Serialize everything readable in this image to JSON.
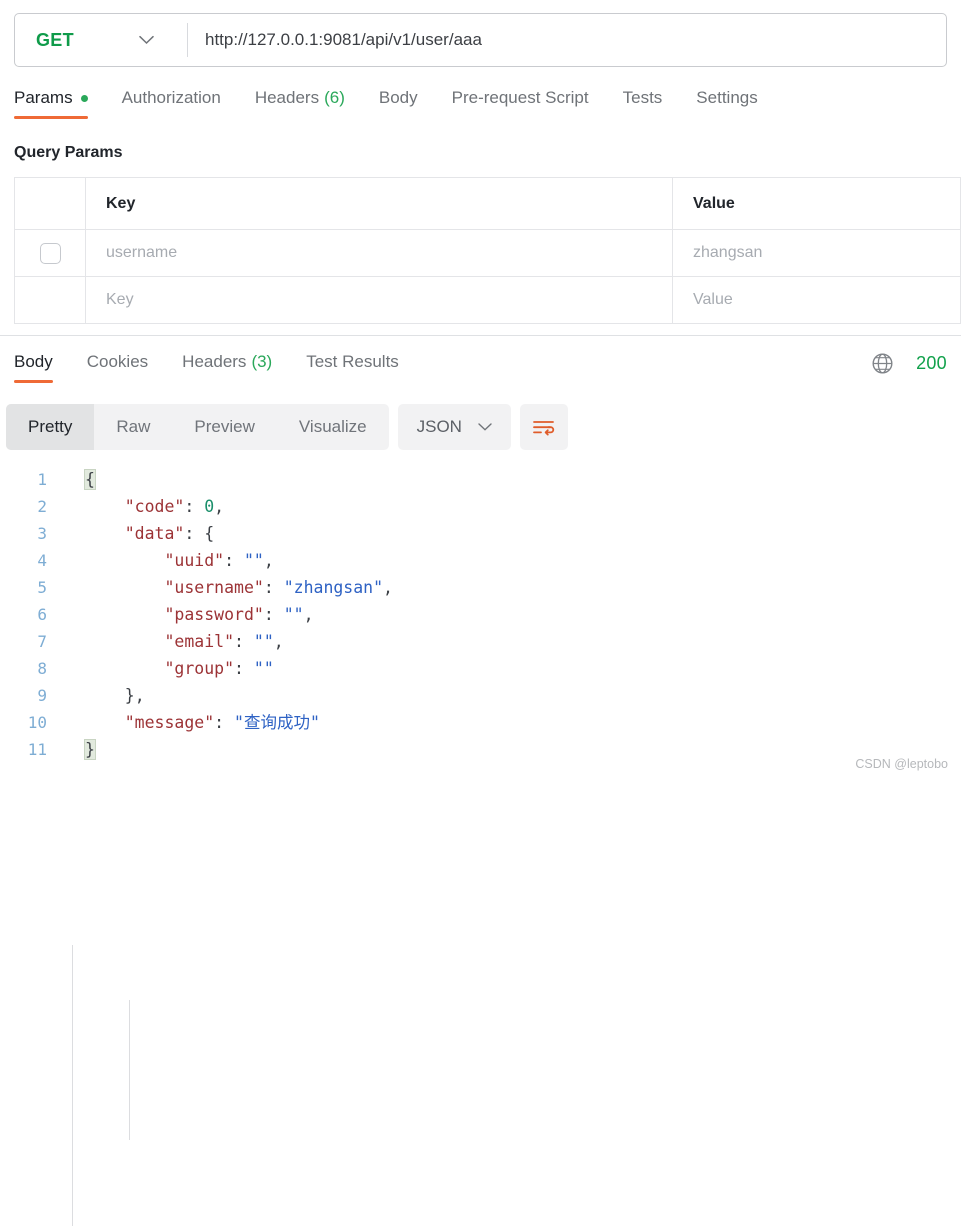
{
  "request": {
    "method": "GET",
    "method_color": "#0f9b4a",
    "url": "http://127.0.0.1:9081/api/v1/user/aaa",
    "url_placeholder": "Enter request URL",
    "caret_icon": "chevron-down-icon"
  },
  "request_tabs": [
    {
      "label": "Params",
      "active": true,
      "dot": true,
      "count": ""
    },
    {
      "label": "Authorization",
      "active": false,
      "dot": false,
      "count": ""
    },
    {
      "label": "Headers",
      "active": false,
      "dot": false,
      "count": "(6)"
    },
    {
      "label": "Body",
      "active": false,
      "dot": false,
      "count": ""
    },
    {
      "label": "Pre-request Script",
      "active": false,
      "dot": false,
      "count": ""
    },
    {
      "label": "Tests",
      "active": false,
      "dot": false,
      "count": ""
    },
    {
      "label": "Settings",
      "active": false,
      "dot": false,
      "count": ""
    }
  ],
  "query_params": {
    "title": "Query Params",
    "columns": {
      "key": "Key",
      "value": "Value"
    },
    "rows": [
      {
        "checked": false,
        "key": "username",
        "value": "zhangsan",
        "is_placeholder": true
      },
      {
        "checked": false,
        "key": "Key",
        "value": "Value",
        "is_placeholder": true
      }
    ]
  },
  "response_tabs": [
    {
      "label": "Body",
      "active": true,
      "count": ""
    },
    {
      "label": "Cookies",
      "active": false,
      "count": ""
    },
    {
      "label": "Headers",
      "active": false,
      "count": "(3)"
    },
    {
      "label": "Test Results",
      "active": false,
      "count": ""
    }
  ],
  "response_status": {
    "globe_icon": "globe-icon",
    "code": "200",
    "code_color": "#11a14b"
  },
  "body_toolbar": {
    "views": [
      {
        "label": "Pretty",
        "active": true
      },
      {
        "label": "Raw",
        "active": false
      },
      {
        "label": "Preview",
        "active": false
      },
      {
        "label": "Visualize",
        "active": false
      }
    ],
    "format": "JSON",
    "format_caret_icon": "chevron-down-icon",
    "wrap_icon": "word-wrap-icon",
    "wrap_icon_color": "#e05c2a"
  },
  "response_body": {
    "language": "json",
    "lines": [
      {
        "n": "1",
        "tokens": [
          {
            "t": "{",
            "c": "punc-hl"
          }
        ]
      },
      {
        "n": "2",
        "tokens": [
          {
            "t": "    ",
            "c": "punc"
          },
          {
            "t": "\"code\"",
            "c": "key"
          },
          {
            "t": ": ",
            "c": "punc"
          },
          {
            "t": "0",
            "c": "num"
          },
          {
            "t": ",",
            "c": "punc"
          }
        ]
      },
      {
        "n": "3",
        "tokens": [
          {
            "t": "    ",
            "c": "punc"
          },
          {
            "t": "\"data\"",
            "c": "key"
          },
          {
            "t": ": ",
            "c": "punc"
          },
          {
            "t": "{",
            "c": "punc"
          }
        ]
      },
      {
        "n": "4",
        "tokens": [
          {
            "t": "        ",
            "c": "punc"
          },
          {
            "t": "\"uuid\"",
            "c": "key"
          },
          {
            "t": ": ",
            "c": "punc"
          },
          {
            "t": "\"\"",
            "c": "str"
          },
          {
            "t": ",",
            "c": "punc"
          }
        ]
      },
      {
        "n": "5",
        "tokens": [
          {
            "t": "        ",
            "c": "punc"
          },
          {
            "t": "\"username\"",
            "c": "key"
          },
          {
            "t": ": ",
            "c": "punc"
          },
          {
            "t": "\"zhangsan\"",
            "c": "str"
          },
          {
            "t": ",",
            "c": "punc"
          }
        ]
      },
      {
        "n": "6",
        "tokens": [
          {
            "t": "        ",
            "c": "punc"
          },
          {
            "t": "\"password\"",
            "c": "key"
          },
          {
            "t": ": ",
            "c": "punc"
          },
          {
            "t": "\"\"",
            "c": "str"
          },
          {
            "t": ",",
            "c": "punc"
          }
        ]
      },
      {
        "n": "7",
        "tokens": [
          {
            "t": "        ",
            "c": "punc"
          },
          {
            "t": "\"email\"",
            "c": "key"
          },
          {
            "t": ": ",
            "c": "punc"
          },
          {
            "t": "\"\"",
            "c": "str"
          },
          {
            "t": ",",
            "c": "punc"
          }
        ]
      },
      {
        "n": "8",
        "tokens": [
          {
            "t": "        ",
            "c": "punc"
          },
          {
            "t": "\"group\"",
            "c": "key"
          },
          {
            "t": ": ",
            "c": "punc"
          },
          {
            "t": "\"\"",
            "c": "str"
          }
        ]
      },
      {
        "n": "9",
        "tokens": [
          {
            "t": "    ",
            "c": "punc"
          },
          {
            "t": "}",
            "c": "punc"
          },
          {
            "t": ",",
            "c": "punc"
          }
        ]
      },
      {
        "n": "10",
        "tokens": [
          {
            "t": "    ",
            "c": "punc"
          },
          {
            "t": "\"message\"",
            "c": "key"
          },
          {
            "t": ": ",
            "c": "punc"
          },
          {
            "t": "\"查询成功\"",
            "c": "str"
          }
        ]
      },
      {
        "n": "11",
        "tokens": [
          {
            "t": "}",
            "c": "punc-hl"
          }
        ]
      }
    ],
    "parsed": {
      "code": 0,
      "data": {
        "uuid": "",
        "username": "zhangsan",
        "password": "",
        "email": "",
        "group": ""
      },
      "message": "查询成功"
    }
  },
  "watermark": "CSDN @leptobo"
}
